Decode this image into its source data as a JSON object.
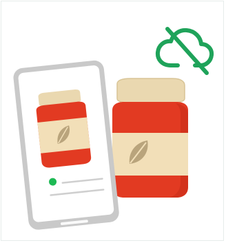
{
  "illustration": {
    "subject": "phone-showing-jar-offline",
    "icons": [
      "cloud-off-icon",
      "phone-icon",
      "jar-icon",
      "leaf-icon",
      "status-dot-icon"
    ]
  },
  "colors": {
    "background": "#ffffff",
    "border": "#e6ecea",
    "cloud_off": "#1fa35a",
    "phone_frame": "#c9c9c9",
    "phone_screen": "#ffffff",
    "jar_red": "#e23a22",
    "jar_red_dark": "#c62b18",
    "jar_label": "#f2dfb8",
    "jar_lid": "#ead8b0",
    "leaf": "#b9a47c",
    "status_dot": "#1db954",
    "line_gray": "#cfcfcf"
  }
}
